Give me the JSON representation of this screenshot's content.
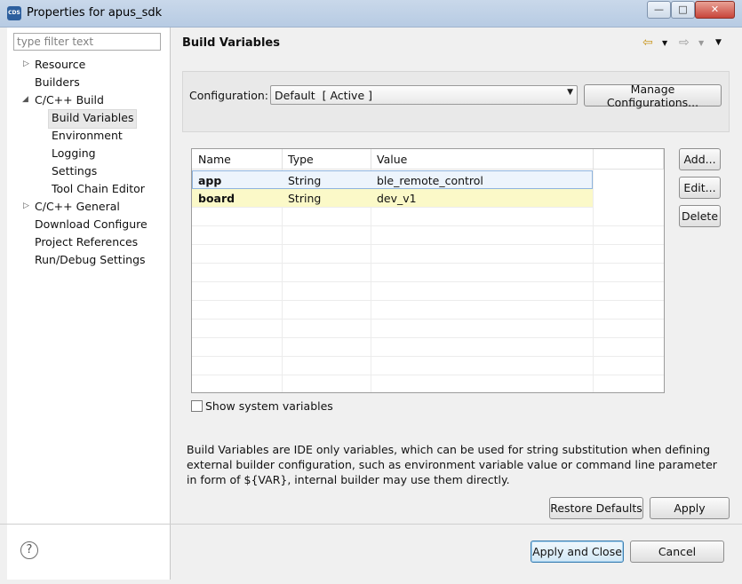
{
  "window": {
    "title": "Properties for apus_sdk",
    "app_icon_text": "CDS"
  },
  "window_controls": {
    "minimize": "—",
    "maximize": "□",
    "close": "✕"
  },
  "sidebar": {
    "filter_placeholder": "type filter text",
    "items": [
      {
        "label": "Resource",
        "expander": "▷"
      },
      {
        "label": "Builders"
      },
      {
        "label": "C/C++ Build",
        "expander": "◢"
      },
      {
        "label": "Build Variables",
        "selected": true
      },
      {
        "label": "Environment"
      },
      {
        "label": "Logging"
      },
      {
        "label": "Settings"
      },
      {
        "label": "Tool Chain Editor"
      },
      {
        "label": "C/C++ General",
        "expander": "▷"
      },
      {
        "label": "Download Configure"
      },
      {
        "label": "Project References"
      },
      {
        "label": "Run/Debug Settings"
      }
    ]
  },
  "page": {
    "title": "Build Variables",
    "nav": {
      "back_icon": "⇦",
      "back_menu": "▼",
      "forward_icon": "⇨",
      "forward_menu": "▼",
      "view_menu": "▼"
    }
  },
  "configuration": {
    "label": "Configuration:",
    "value": "Default  [ Active ]",
    "manage_button": "Manage Configurations..."
  },
  "variables_table": {
    "columns": [
      "Name",
      "Type",
      "Value"
    ],
    "rows": [
      {
        "name": "app",
        "type": "String",
        "value": "ble_remote_control"
      },
      {
        "name": "board",
        "type": "String",
        "value": "dev_v1"
      }
    ]
  },
  "side_buttons": {
    "add": "Add...",
    "edit": "Edit...",
    "delete": "Delete"
  },
  "show_system_variables": {
    "label": "Show system variables",
    "checked": false
  },
  "description": "Build Variables are IDE only variables, which can be used for string substitution when defining external builder configuration, such as environment variable value or command line parameter in form of ${VAR}, internal builder may use them directly.",
  "buttons": {
    "restore_defaults": "Restore Defaults",
    "apply": "Apply",
    "apply_and_close": "Apply and Close",
    "cancel": "Cancel",
    "help": "?"
  }
}
